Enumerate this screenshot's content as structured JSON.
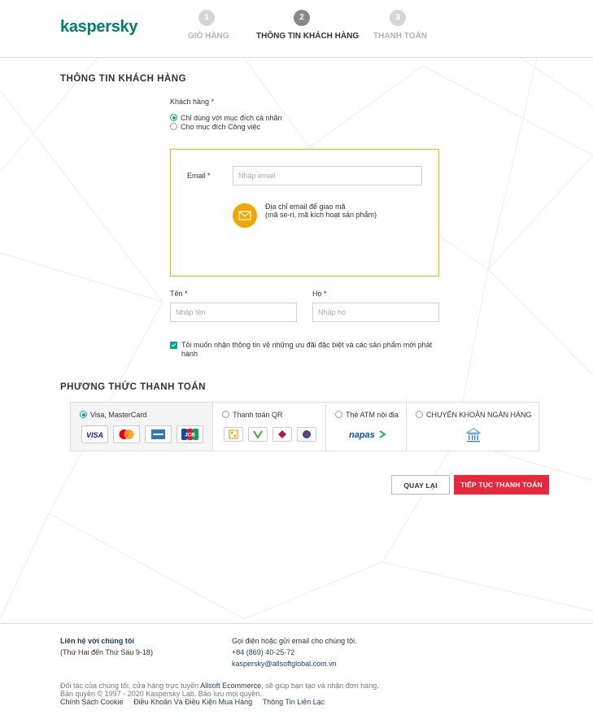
{
  "brand": {
    "logo": "kaspersky",
    "color": "#00806a"
  },
  "steps": [
    {
      "number": "1",
      "label": "GIỎ HÀNG",
      "state": "done"
    },
    {
      "number": "2",
      "label": "THÔNG TIN KHÁCH HÀNG",
      "state": "active"
    },
    {
      "number": "3",
      "label": "THANH TOÁN",
      "state": "todo"
    }
  ],
  "customer": {
    "title": "THÔNG TIN KHÁCH HÀNG",
    "type_label": "Khách hàng *",
    "options": [
      {
        "label": "Chỉ dùng với mục đích cá nhân",
        "checked": true
      },
      {
        "label": "Cho mục đích Công việc",
        "checked": false
      }
    ],
    "email_label": "Email *",
    "email_placeholder": "Nhập email",
    "email_note_line1": "Địa chỉ email để giao mã",
    "email_note_line2": "(mã se-ri, mã kích hoạt sản phẩm)",
    "first_name_label": "Tên *",
    "first_name_placeholder": "Nhập tên",
    "last_name_label": "Họ *",
    "last_name_placeholder": "Nhập họ",
    "consent_text": "Tôi muốn nhận thông tin về những ưu đãi đặc biệt và các sản phẩm mới phát hành",
    "consent_checked": true
  },
  "payment": {
    "title": "PHƯƠNG THỨC THANH TOÁN",
    "methods": [
      {
        "label": "Visa, MasterCard",
        "checked": true,
        "icons": [
          "VISA",
          "mastercard-icon",
          "amex-icon",
          "JCB"
        ]
      },
      {
        "label": "Thanh toán QR",
        "checked": false,
        "icons": [
          "qr-icon",
          "vietcombank-icon",
          "agribank-icon",
          "vietinbank-icon"
        ]
      },
      {
        "label": "Thẻ ATM nội địa",
        "checked": false,
        "logo": "napas"
      },
      {
        "label": "CHUYỂN KHOẢN NGÂN HÀNG",
        "checked": false,
        "icons": [
          "bank-icon"
        ]
      }
    ]
  },
  "buttons": {
    "back": "QUAY LẠI",
    "next": "TIẾP TỤC THANH TOÁN"
  },
  "colors": {
    "accent": "#00a88e",
    "primary_button": "#e8293c",
    "highlight_border": "#e4b800",
    "mail_icon": "#f2a600"
  },
  "footer": {
    "contact_title": "Liên hệ với chúng tôi",
    "contact_hours": "(Thứ Hai đến Thứ Sáu 9-18)",
    "call_text": "Gọi điện hoặc gửi email cho chúng tôi.",
    "phone": "+84 (869) 40-25-72",
    "email": "kaspersky@allsoftglobal.com.vn",
    "partner_text_before": "Đối tác của chúng tôi, cửa hàng trực tuyến ",
    "partner_name": "Allsoft Ecommerce",
    "partner_text_after": ", sẽ giúp bạn tạo và nhận đơn hàng.",
    "copyright": "Bản quyền © 1997 - 2020 Kaspersky Lab. Bảo lưu mọi quyền.",
    "links": [
      "Chính Sách Cookie",
      "Điều Khoản Và Điều Kiện Mua Hàng",
      "Thông Tin Liên Lạc"
    ]
  }
}
